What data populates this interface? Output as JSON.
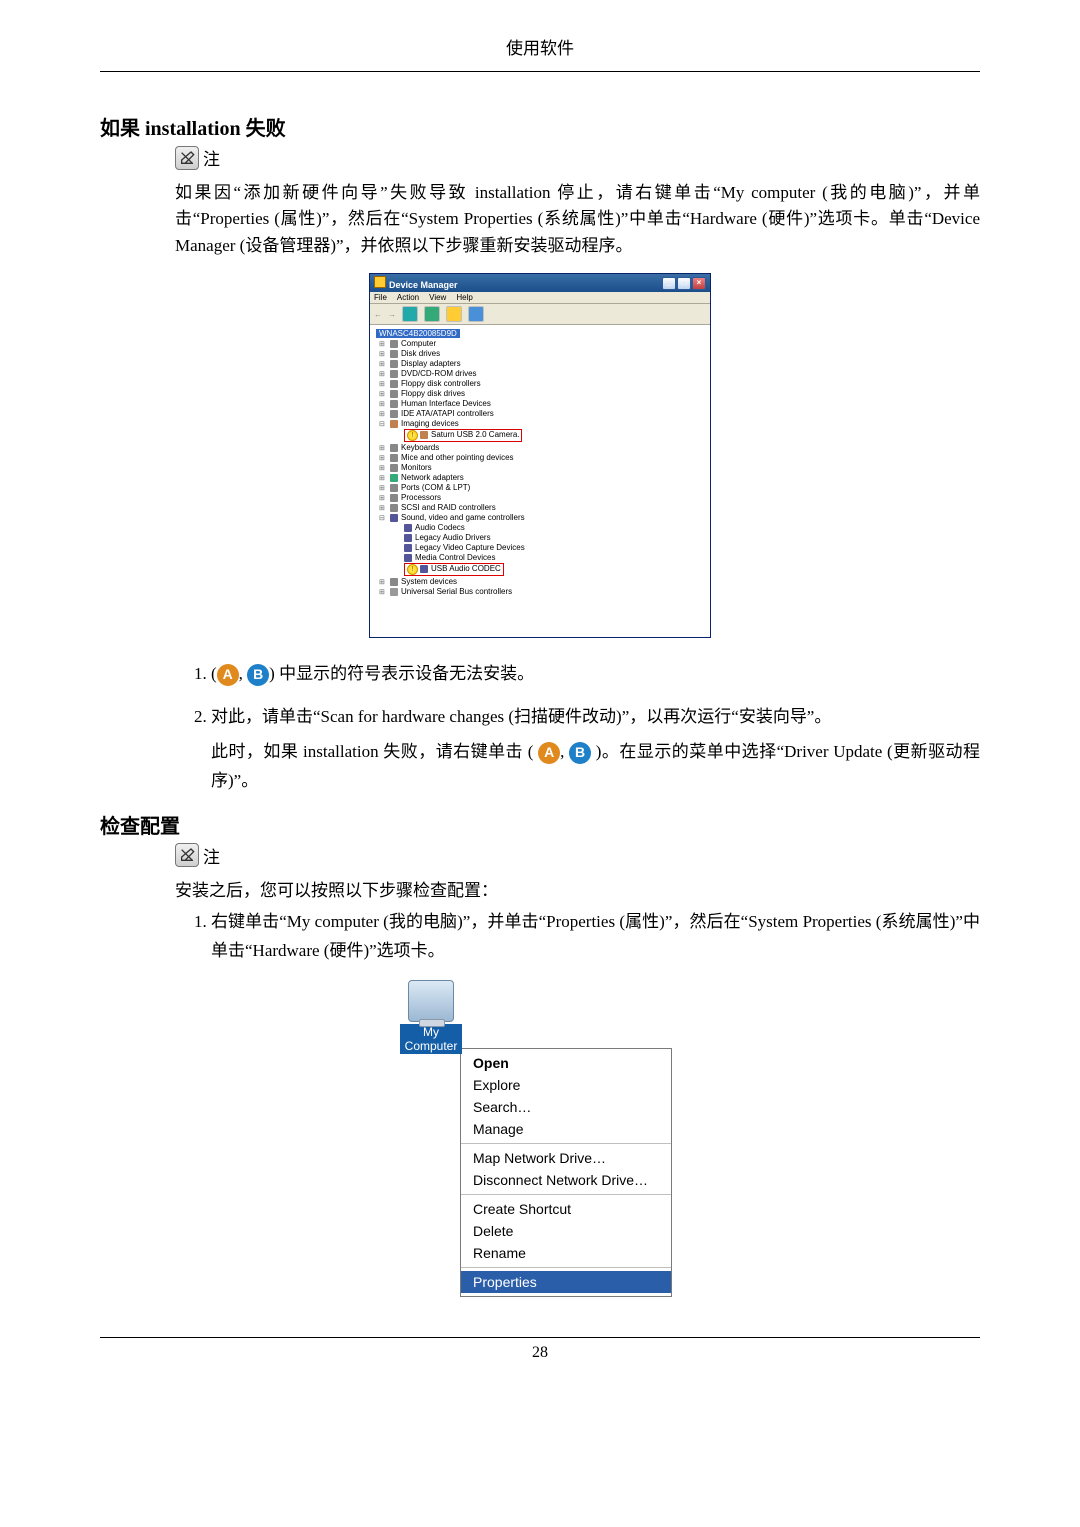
{
  "header": {
    "title": "使用软件"
  },
  "footer": {
    "page_number": "28"
  },
  "section1": {
    "heading_prefix": "如果 ",
    "heading_bold": "installation",
    "heading_suffix": " 失败",
    "note_label": "注",
    "para1": "如果因“添加新硬件向导”失败导致 installation 停止，请右键单击“My computer (我的电脑)”，并单击“Properties (属性)”，然后在“System Properties (系统属性)”中单击“Hardware (硬件)”选项卡。单击“Device Manager (设备管理器)”，并依照以下步骤重新安装驱动程序。"
  },
  "device_manager": {
    "title": "Device Manager",
    "menu": [
      "File",
      "Action",
      "View",
      "Help"
    ],
    "root": "WNASC4B20085D9D",
    "nodes": [
      {
        "label": "Computer",
        "icon": "cpu"
      },
      {
        "label": "Disk drives",
        "icon": "cpu"
      },
      {
        "label": "Display adapters",
        "icon": "cpu"
      },
      {
        "label": "DVD/CD-ROM drives",
        "icon": "cpu"
      },
      {
        "label": "Floppy disk controllers",
        "icon": "cpu"
      },
      {
        "label": "Floppy disk drives",
        "icon": "cpu"
      },
      {
        "label": "Human Interface Devices",
        "icon": "cpu"
      },
      {
        "label": "IDE ATA/ATAPI controllers",
        "icon": "cpu"
      }
    ],
    "imaging": {
      "label": "Imaging devices",
      "child_warn": "Saturn USB 2.0 Camera."
    },
    "nodes2": [
      {
        "label": "Keyboards",
        "icon": "cpu"
      },
      {
        "label": "Mice and other pointing devices",
        "icon": "cpu"
      },
      {
        "label": "Monitors",
        "icon": "cpu"
      },
      {
        "label": "Network adapters",
        "icon": "net"
      },
      {
        "label": "Ports (COM & LPT)",
        "icon": "cpu"
      },
      {
        "label": "Processors",
        "icon": "cpu"
      },
      {
        "label": "SCSI and RAID controllers",
        "icon": "cpu"
      }
    ],
    "sound": {
      "label": "Sound, video and game controllers",
      "children": [
        "Audio Codecs",
        "Legacy Audio Drivers",
        "Legacy Video Capture Devices",
        "Media Control Devices"
      ],
      "warn_child": "USB Audio CODEC"
    },
    "nodes3": [
      {
        "label": "System devices",
        "icon": "cpu"
      },
      {
        "label": "Universal Serial Bus controllers",
        "icon": "usb"
      }
    ]
  },
  "steps": {
    "s1_prefix": "(",
    "s1_mid": ", ",
    "s1_suffix": ") 中显示的符号表示设备无法安装。",
    "s2_line1": "对此，请单击“Scan for hardware changes (扫描硬件改动)”，以再次运行“安装向导”。",
    "s2_line2_a": "此时，如果 installation 失败，请右键单击 ( ",
    "s2_line2_b": " )。在显示的菜单中选择“Driver Update (更新驱动程序)”。"
  },
  "section2": {
    "heading": "检查配置",
    "note_label": "注",
    "para1": "安装之后，您可以按照以下步骤检查配置：",
    "n1": "右键单击“My computer (我的电脑)”，并单击“Properties (属性)”，然后在“System Properties (系统属性)”中单击“Hardware (硬件)”选项卡。"
  },
  "context_menu": {
    "icon_label": "My Computer",
    "groups": [
      {
        "items": [
          {
            "t": "Open",
            "bold": true
          },
          {
            "t": "Explore"
          },
          {
            "t": "Search…"
          },
          {
            "t": "Manage"
          }
        ]
      },
      {
        "items": [
          {
            "t": "Map Network Drive…"
          },
          {
            "t": "Disconnect Network Drive…"
          }
        ]
      },
      {
        "items": [
          {
            "t": "Create Shortcut"
          },
          {
            "t": "Delete"
          },
          {
            "t": "Rename"
          }
        ]
      },
      {
        "items": [
          {
            "t": "Properties",
            "sel": true
          }
        ]
      }
    ]
  },
  "badges": {
    "A": "A",
    "B": "B"
  }
}
